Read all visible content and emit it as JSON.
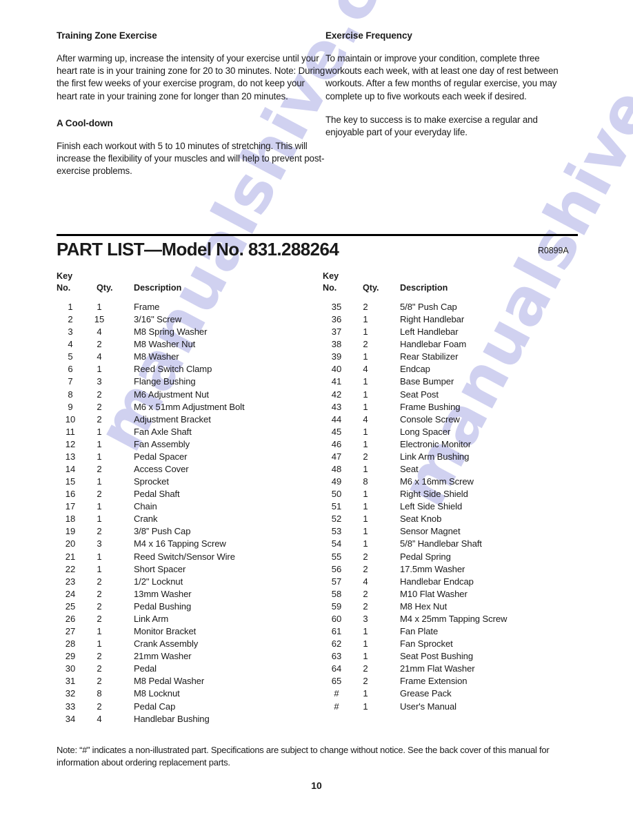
{
  "watermark": {
    "text": "manualshive.com",
    "color": "#c8c9ee"
  },
  "top_sections": {
    "left": {
      "heading1": "Training Zone Exercise",
      "paragraph1": "After warming up, increase the intensity of your exercise until your heart rate is in your training zone for 20 to 30 minutes. Note: During the first few weeks of your exercise program, do not keep your heart rate in your training zone for longer than 20 minutes.",
      "heading2": "A Cool-down",
      "paragraph2": "Finish each workout with 5 to 10 minutes of stretching. This will increase the flexibility of your muscles and will help to prevent post-exercise problems."
    },
    "right": {
      "heading1": "Exercise Frequency",
      "paragraph1": "To maintain or improve your condition, complete three workouts each week, with at least one day of rest between workouts. After a few months of regular exercise, you may complete up to five workouts each week if desired.",
      "paragraph2": "The key to success is to make exercise a regular and enjoyable part of your everyday life."
    }
  },
  "part_list": {
    "title": "PART LIST—Model No. 831.288264",
    "revision": "R0899A",
    "headers": {
      "key_line1": "Key",
      "key_line2": "No.",
      "qty": "Qty.",
      "description": "Description"
    },
    "column_left": [
      {
        "key": "1",
        "qty": "1",
        "description": "Frame"
      },
      {
        "key": "2",
        "qty": "15",
        "description": "3/16\" Screw"
      },
      {
        "key": "3",
        "qty": "4",
        "description": "M8 Spring Washer"
      },
      {
        "key": "4",
        "qty": "2",
        "description": "M8 Washer Nut"
      },
      {
        "key": "5",
        "qty": "4",
        "description": "M8 Washer"
      },
      {
        "key": "6",
        "qty": "1",
        "description": "Reed Switch Clamp"
      },
      {
        "key": "7",
        "qty": "3",
        "description": "Flange Bushing"
      },
      {
        "key": "8",
        "qty": "2",
        "description": "M6 Adjustment Nut"
      },
      {
        "key": "9",
        "qty": "2",
        "description": "M6 x 51mm Adjustment Bolt"
      },
      {
        "key": "10",
        "qty": "2",
        "description": "Adjustment Bracket"
      },
      {
        "key": "11",
        "qty": "1",
        "description": "Fan Axle Shaft"
      },
      {
        "key": "12",
        "qty": "1",
        "description": "Fan Assembly"
      },
      {
        "key": "13",
        "qty": "1",
        "description": "Pedal Spacer"
      },
      {
        "key": "14",
        "qty": "2",
        "description": "Access Cover"
      },
      {
        "key": "15",
        "qty": "1",
        "description": "Sprocket"
      },
      {
        "key": "16",
        "qty": "2",
        "description": "Pedal Shaft"
      },
      {
        "key": "17",
        "qty": "1",
        "description": "Chain"
      },
      {
        "key": "18",
        "qty": "1",
        "description": "Crank"
      },
      {
        "key": "19",
        "qty": "2",
        "description": "3/8” Push Cap"
      },
      {
        "key": "20",
        "qty": "3",
        "description": "M4 x 16 Tapping Screw"
      },
      {
        "key": "21",
        "qty": "1",
        "description": "Reed Switch/Sensor Wire"
      },
      {
        "key": "22",
        "qty": "1",
        "description": "Short Spacer"
      },
      {
        "key": "23",
        "qty": "2",
        "description": "1/2\" Locknut"
      },
      {
        "key": "24",
        "qty": "2",
        "description": "13mm Washer"
      },
      {
        "key": "25",
        "qty": "2",
        "description": "Pedal Bushing"
      },
      {
        "key": "26",
        "qty": "2",
        "description": "Link Arm"
      },
      {
        "key": "27",
        "qty": "1",
        "description": "Monitor Bracket"
      },
      {
        "key": "28",
        "qty": "1",
        "description": "Crank Assembly"
      },
      {
        "key": "29",
        "qty": "2",
        "description": "21mm Washer"
      },
      {
        "key": "30",
        "qty": "2",
        "description": "Pedal"
      },
      {
        "key": "31",
        "qty": "2",
        "description": "M8 Pedal Washer"
      },
      {
        "key": "32",
        "qty": "8",
        "description": "M8 Locknut"
      },
      {
        "key": "33",
        "qty": "2",
        "description": "Pedal Cap"
      },
      {
        "key": "34",
        "qty": "4",
        "description": "Handlebar Bushing"
      }
    ],
    "column_right": [
      {
        "key": "35",
        "qty": "2",
        "description": "5/8\" Push Cap"
      },
      {
        "key": "36",
        "qty": "1",
        "description": "Right Handlebar"
      },
      {
        "key": "37",
        "qty": "1",
        "description": "Left Handlebar"
      },
      {
        "key": "38",
        "qty": "2",
        "description": "Handlebar Foam"
      },
      {
        "key": "39",
        "qty": "1",
        "description": "Rear Stabilizer"
      },
      {
        "key": "40",
        "qty": "4",
        "description": "Endcap"
      },
      {
        "key": "41",
        "qty": "1",
        "description": "Base Bumper"
      },
      {
        "key": "42",
        "qty": "1",
        "description": "Seat Post"
      },
      {
        "key": "43",
        "qty": "1",
        "description": "Frame Bushing"
      },
      {
        "key": "44",
        "qty": "4",
        "description": "Console Screw"
      },
      {
        "key": "45",
        "qty": "1",
        "description": "Long Spacer"
      },
      {
        "key": "46",
        "qty": "1",
        "description": "Electronic Monitor"
      },
      {
        "key": "47",
        "qty": "2",
        "description": "Link Arm Bushing"
      },
      {
        "key": "48",
        "qty": "1",
        "description": "Seat"
      },
      {
        "key": "49",
        "qty": "8",
        "description": "M6 x 16mm Screw"
      },
      {
        "key": "50",
        "qty": "1",
        "description": "Right Side Shield"
      },
      {
        "key": "51",
        "qty": "1",
        "description": "Left Side Shield"
      },
      {
        "key": "52",
        "qty": "1",
        "description": "Seat Knob"
      },
      {
        "key": "53",
        "qty": "1",
        "description": "Sensor Magnet"
      },
      {
        "key": "54",
        "qty": "1",
        "description": "5/8” Handlebar Shaft"
      },
      {
        "key": "55",
        "qty": "2",
        "description": "Pedal Spring"
      },
      {
        "key": "56",
        "qty": "2",
        "description": "17.5mm Washer"
      },
      {
        "key": "57",
        "qty": "4",
        "description": "Handlebar Endcap"
      },
      {
        "key": "58",
        "qty": "2",
        "description": "M10 Flat Washer"
      },
      {
        "key": "59",
        "qty": "2",
        "description": "M8 Hex Nut"
      },
      {
        "key": "60",
        "qty": "3",
        "description": "M4 x 25mm Tapping Screw"
      },
      {
        "key": "61",
        "qty": "1",
        "description": "Fan Plate"
      },
      {
        "key": "62",
        "qty": "1",
        "description": "Fan Sprocket"
      },
      {
        "key": "63",
        "qty": "1",
        "description": "Seat Post Bushing"
      },
      {
        "key": "64",
        "qty": "2",
        "description": "21mm Flat Washer"
      },
      {
        "key": "65",
        "qty": "2",
        "description": "Frame Extension"
      },
      {
        "key": "#",
        "qty": "1",
        "description": "Grease Pack"
      },
      {
        "key": "#",
        "qty": "1",
        "description": "User's Manual"
      }
    ]
  },
  "footer": {
    "note": "Note: “#” indicates a non-illustrated part. Specifications are subject to change without notice. See the back cover of this manual for information about ordering replacement parts.",
    "page_number": "10"
  }
}
